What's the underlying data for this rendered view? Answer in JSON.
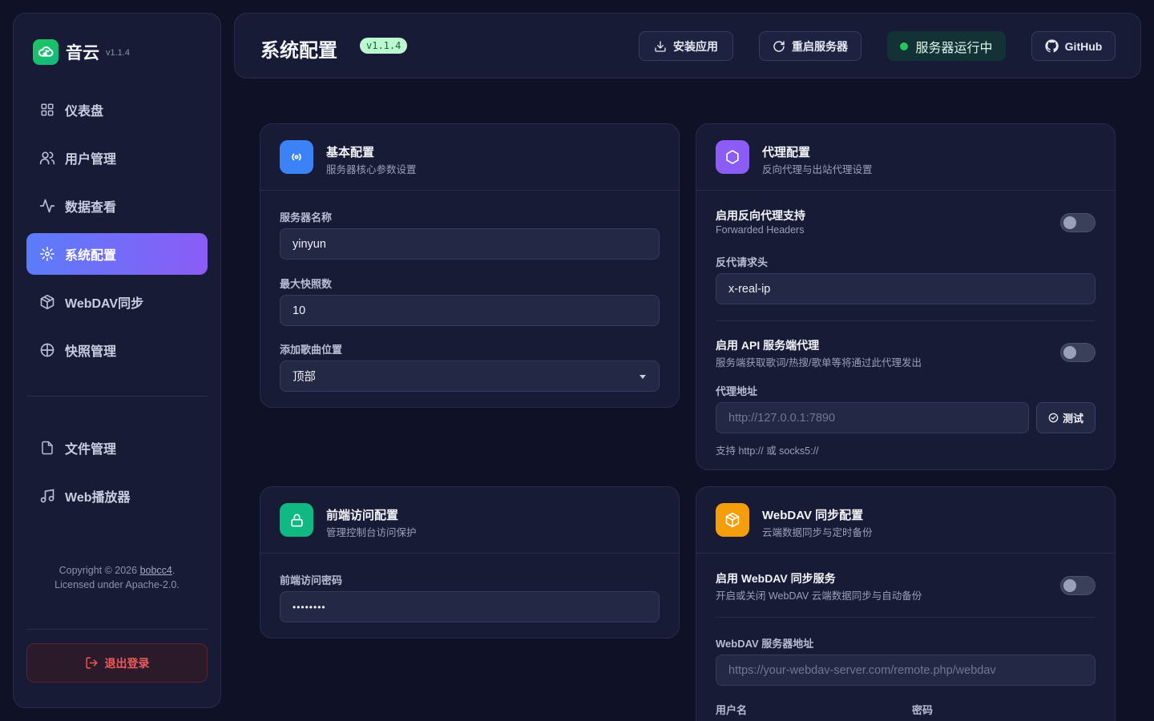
{
  "brand": {
    "name": "音云",
    "version": "v1.1.4"
  },
  "sidebar": {
    "items": [
      {
        "label": "仪表盘",
        "icon": "dashboard-icon"
      },
      {
        "label": "用户管理",
        "icon": "users-icon"
      },
      {
        "label": "数据查看",
        "icon": "activity-icon"
      },
      {
        "label": "系统配置",
        "icon": "settings-icon",
        "active": true
      },
      {
        "label": "WebDAV同步",
        "icon": "package-icon"
      },
      {
        "label": "快照管理",
        "icon": "snapshot-icon"
      }
    ],
    "items2": [
      {
        "label": "文件管理",
        "icon": "file-icon"
      },
      {
        "label": "Web播放器",
        "icon": "music-icon"
      }
    ],
    "copyright_prefix": "Copyright © 2026 ",
    "copyright_author": "bobcc4",
    "copyright_suffix": ".",
    "license": "Licensed under Apache-2.0.",
    "logout": "退出登录"
  },
  "header": {
    "title": "系统配置",
    "version_badge": "v1.1.4",
    "install_label": "安装应用",
    "restart_label": "重启服务器",
    "status_label": "服务器运行中",
    "github_label": "GitHub"
  },
  "basic": {
    "title": "基本配置",
    "subtitle": "服务器核心参数设置",
    "server_name_label": "服务器名称",
    "server_name_value": "yinyun",
    "max_snapshots_label": "最大快照数",
    "max_snapshots_value": "10",
    "add_song_label": "添加歌曲位置",
    "add_song_value": "顶部"
  },
  "proxy": {
    "title": "代理配置",
    "subtitle": "反向代理与出站代理设置",
    "reverse_title": "启用反向代理支持",
    "reverse_sub": "Forwarded Headers",
    "reverse_enabled": false,
    "header_label": "反代请求头",
    "header_value": "x-real-ip",
    "api_title": "启用 API 服务端代理",
    "api_sub": "服务端获取歌词/热搜/歌单等将通过此代理发出",
    "api_enabled": false,
    "addr_label": "代理地址",
    "addr_placeholder": "http://127.0.0.1:7890",
    "test_label": "测试",
    "hint": "支持 http:// 或 socks5://"
  },
  "frontend": {
    "title": "前端访问配置",
    "subtitle": "管理控制台访问保护",
    "password_label": "前端访问密码",
    "password_value": "••••••••"
  },
  "webdav": {
    "title": "WebDAV 同步配置",
    "subtitle": "云端数据同步与定时备份",
    "enable_title": "启用 WebDAV 同步服务",
    "enable_sub": "开启或关闭 WebDAV 云端数据同步与自动备份",
    "enabled": false,
    "url_label": "WebDAV 服务器地址",
    "url_placeholder": "https://your-webdav-server.com/remote.php/webdav",
    "username_label": "用户名",
    "password_label": "密码"
  },
  "colors": {
    "accent_start": "#5b7cfa",
    "accent_end": "#8b5cf6",
    "basic_icon": "#3b82f6",
    "proxy_icon": "#8b5cf6",
    "frontend_icon": "#10b981",
    "webdav_icon": "#f59e0b",
    "status_green": "#22c55e",
    "logout_red": "#f05a5a"
  }
}
